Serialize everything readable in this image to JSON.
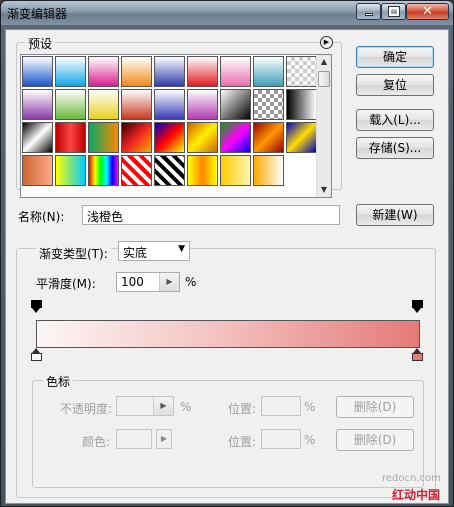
{
  "window": {
    "title": "渐变编辑器"
  },
  "titlebar_buttons": {
    "close": "✕"
  },
  "presets": {
    "legend": "预设",
    "swatches": [
      "linear-gradient(180deg,#fff,#1a55c9)",
      "linear-gradient(180deg,#fff,#10a7e8)",
      "linear-gradient(180deg,#fff,#d81f8f)",
      "linear-gradient(180deg,#fff,#f08a1a)",
      "linear-gradient(180deg,#fff,#2f3aa8)",
      "linear-gradient(180deg,#fff,#e01c22)",
      "linear-gradient(180deg,#fff,#e86fb0)",
      "linear-gradient(180deg,#fff,#40a0b8)",
      "repeating-conic-gradient(#ccc 0 25%,#fff 0 50%) 0 0/8px 8px",
      "linear-gradient(180deg,#fff,#8a3aa8)",
      "linear-gradient(180deg,#fff,#6ab83a)",
      "linear-gradient(180deg,#fff,#e8d020)",
      "linear-gradient(180deg,#fff,#c83a20)",
      "linear-gradient(180deg,#fff,#3a3ab8)",
      "linear-gradient(180deg,#fff,#b03ab0)",
      "linear-gradient(135deg,#fff,#000)",
      "repeating-conic-gradient(#999 0 25%,#fff 0 50%) 0 0/8px 8px",
      "linear-gradient(90deg,#000,#fff)",
      "linear-gradient(135deg,#000,#fff 50%,#000)",
      "linear-gradient(90deg,#b00,#f44,#b00)",
      "linear-gradient(90deg,#0a6,#f80)",
      "linear-gradient(135deg,#300,#e22,#fa0)",
      "linear-gradient(135deg,#00c,#f00,#ff0)",
      "linear-gradient(135deg,#c60,#fe0,#c60)",
      "linear-gradient(135deg,#0a0,#f0f,#00f)",
      "linear-gradient(135deg,#900,#f90,#900)",
      "linear-gradient(135deg,#00c,#fd0,#00c)",
      "linear-gradient(90deg,#c63,#fa8)",
      "linear-gradient(90deg,#ff0,#0cf)",
      "linear-gradient(90deg,#f00,#ff0,#0f0,#0ff,#00f,#f0f)",
      "repeating-linear-gradient(45deg,#f00 0 4px,#fff 4px 8px)",
      "repeating-linear-gradient(45deg,#000 0 4px,#fff 4px 8px)",
      "linear-gradient(90deg,#ff0,#f80,#ff0)",
      "linear-gradient(90deg,#fc0,#fff6b0)",
      "linear-gradient(90deg,#fa0,#fff)"
    ]
  },
  "buttons": {
    "ok": "确定",
    "reset": "复位",
    "load": "载入(L)...",
    "save": "存储(S)...",
    "new": "新建(W)",
    "delete_opacity": "删除(D)",
    "delete_color": "删除(D)"
  },
  "name_row": {
    "label": "名称(N):",
    "value": "浅橙色"
  },
  "gradient_type": {
    "label": "渐变类型(T):",
    "value": "实底"
  },
  "smoothness": {
    "label": "平滑度(M):",
    "value": "100",
    "unit": "%"
  },
  "gradient": {
    "start_color": "#fdf6f6",
    "mid_color": "#f3c5c3",
    "end_color": "#e57a78"
  },
  "color_stops": {
    "legend": "色标",
    "opacity_label": "不透明度:",
    "opacity_unit": "%",
    "location_label_1": "位置:",
    "location_unit_1": "%",
    "color_label": "颜色:",
    "location_label_2": "位置:",
    "location_unit_2": "%"
  },
  "watermarks": {
    "site": "redocn.com",
    "brand": "红动中国"
  }
}
